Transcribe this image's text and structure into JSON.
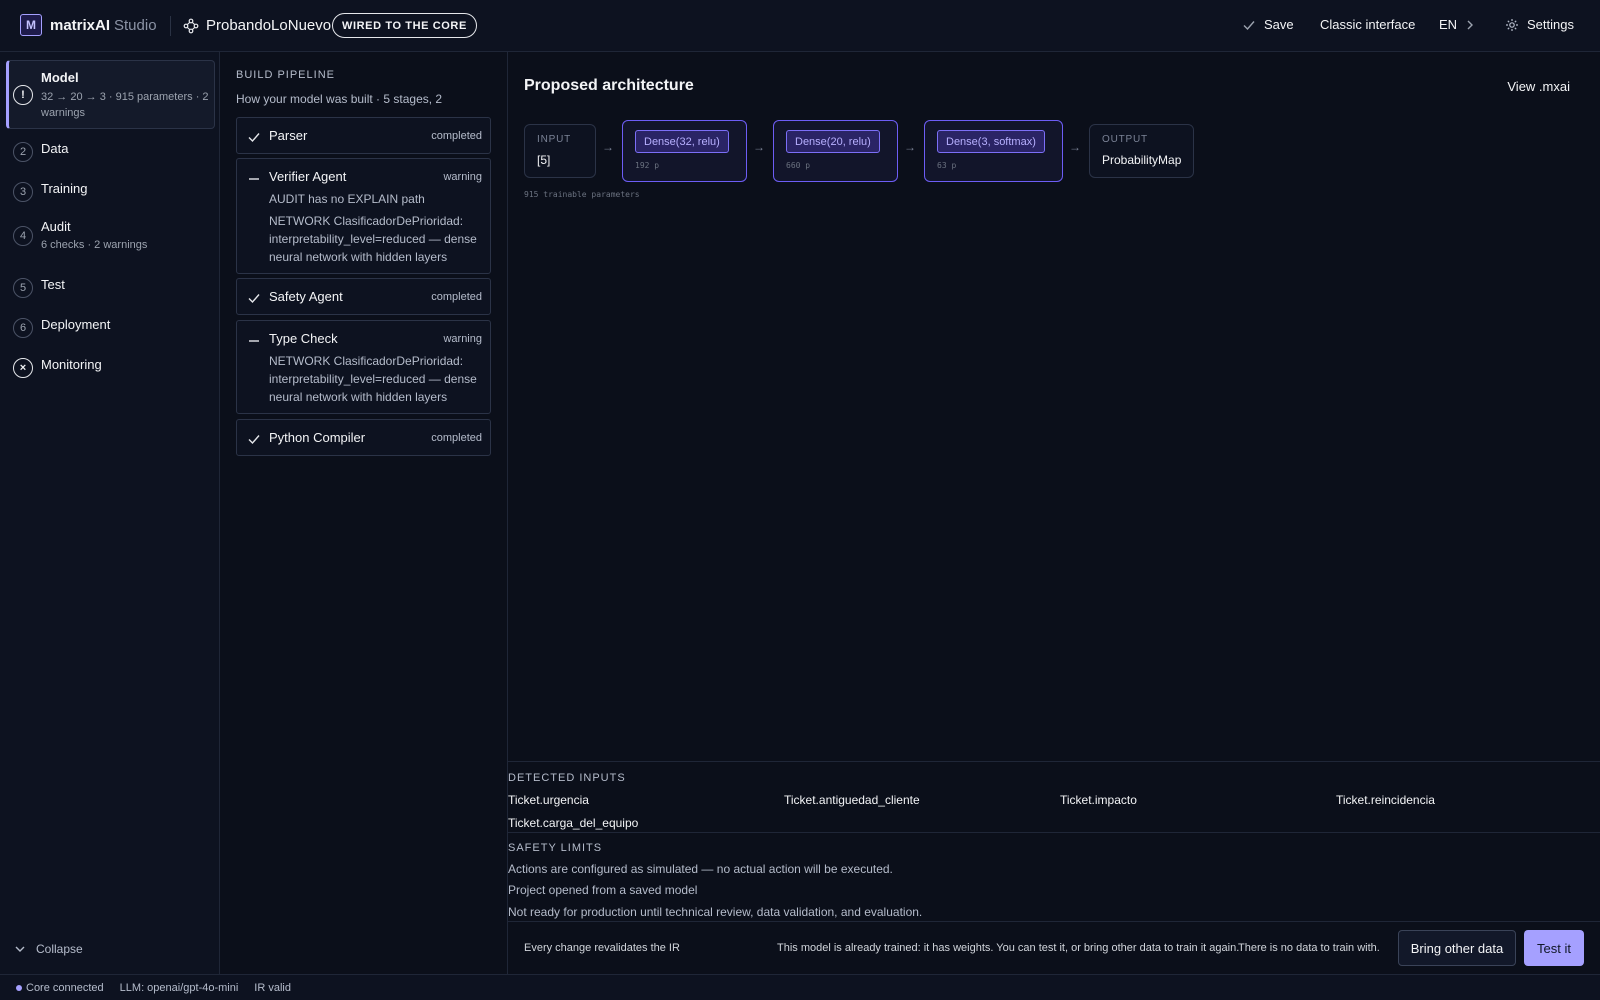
{
  "app": {
    "logo_letter": "M",
    "brand": "matrixAI",
    "brand_sub": "Studio",
    "project_name": "ProbandoLoNuevo",
    "core_badge": "WIRED TO THE CORE",
    "save_label": "Save",
    "classic_label": "Classic interface",
    "lang_label": "EN",
    "settings_label": "Settings"
  },
  "sidebar": {
    "steps": [
      {
        "num": "!",
        "title": "Model",
        "sub": "32 → 20 → 3 · 915 parameters · 2 warnings",
        "active": true
      },
      {
        "num": "2",
        "title": "Data",
        "sub": ""
      },
      {
        "num": "3",
        "title": "Training",
        "sub": ""
      },
      {
        "num": "4",
        "title": "Audit",
        "sub": "6 checks · 2 warnings"
      },
      {
        "num": "5",
        "title": "Test",
        "sub": ""
      },
      {
        "num": "6",
        "title": "Deployment",
        "sub": ""
      },
      {
        "num": "×",
        "title": "Monitoring",
        "sub": ""
      }
    ],
    "collapse_label": "Collapse"
  },
  "pipeline": {
    "heading": "BUILD PIPELINE",
    "description": "How your model was built · 5 stages, 2",
    "stages": [
      {
        "name": "Parser",
        "status": "completed",
        "details": []
      },
      {
        "name": "Verifier Agent",
        "status": "warning",
        "details": [
          "AUDIT has no EXPLAIN path",
          "NETWORK ClasificadorDePrioridad: interpretability_level=reduced — dense neural network with hidden layers"
        ]
      },
      {
        "name": "Safety Agent",
        "status": "completed",
        "details": []
      },
      {
        "name": "Type Check",
        "status": "warning",
        "details": [
          "NETWORK ClasificadorDePrioridad: interpretability_level=reduced — dense neural network with hidden layers"
        ]
      },
      {
        "name": "Python Compiler",
        "status": "completed",
        "details": []
      }
    ]
  },
  "architecture": {
    "title": "Proposed architecture",
    "view_label": "View .mxai",
    "input_label": "INPUT",
    "input_value": "[5]",
    "layers": [
      {
        "label": "Dense(32, relu)",
        "params": "192 p"
      },
      {
        "label": "Dense(20, relu)",
        "params": "660 p"
      },
      {
        "label": "Dense(3, softmax)",
        "params": "63 p"
      }
    ],
    "output_label": "OUTPUT",
    "output_value": "ProbabilityMap",
    "arrow": "→",
    "trainable": "915 trainable parameters"
  },
  "detected_inputs": {
    "heading": "DETECTED INPUTS",
    "items": [
      "Ticket.urgencia",
      "Ticket.antiguedad_cliente",
      "Ticket.impacto",
      "Ticket.reincidencia",
      "Ticket.carga_del_equipo"
    ]
  },
  "safety_limits": {
    "heading": "SAFETY LIMITS",
    "lines": [
      "Actions are configured as simulated — no actual action will be executed.",
      "Project opened from a saved model",
      "Not ready for production until technical review, data validation, and evaluation."
    ]
  },
  "bottom_bar": {
    "note": "Every change revalidates the IR",
    "info_trained": "This model is already trained: it has weights. You can test it, or bring other data to train it again.",
    "info_nodata": "There is no data to train with.",
    "bring_data_label": "Bring other data",
    "test_label": "Test it"
  },
  "status_bar": {
    "core": "Core connected",
    "llm": "LLM: openai/gpt-4o-mini",
    "ir": "IR valid"
  },
  "colors": {
    "accent": "#a5a0ff",
    "background": "#0b0f1a",
    "panel": "#0d1220"
  }
}
